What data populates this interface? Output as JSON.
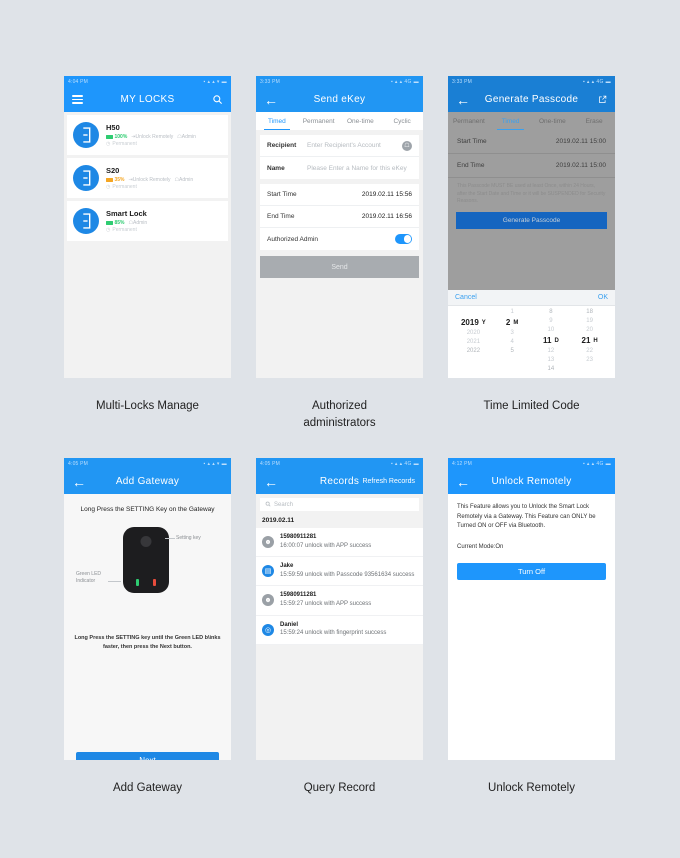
{
  "screens": [
    {
      "caption": "Multi-Locks Manage",
      "statusbar": {
        "time": "4:04 PM",
        "icons": "▪ ▴ ▴ ▾ ▬"
      },
      "nav": {
        "title": "MY LOCKS",
        "menu_icon": "hamburger-icon",
        "search_icon": "search-icon"
      },
      "locks": [
        {
          "name": "H50",
          "battery": "100%",
          "battery_color": "#2ecc71",
          "unlock": "Unlock Remotely",
          "role": "Admin",
          "period": "Permanent"
        },
        {
          "name": "S20",
          "battery": "35%",
          "battery_color": "#f5a623",
          "unlock": "Unlock Remotely",
          "role": "Admin",
          "period": "Permanent"
        },
        {
          "name": "Smart Lock",
          "battery": "85%",
          "battery_color": "#2ecc71",
          "unlock": "",
          "role": "Admin",
          "period": "Permanent"
        }
      ]
    },
    {
      "caption": "Authorized\nadministrators",
      "statusbar": {
        "time": "3:33 PM",
        "icons": "▪ ▴ ▴ 4G ▬"
      },
      "nav": {
        "title": "Send eKey",
        "back_icon": "back-arrow-icon"
      },
      "tabs": [
        {
          "label": "Timed",
          "active": true
        },
        {
          "label": "Permanent",
          "active": false
        },
        {
          "label": "One-time",
          "active": false
        },
        {
          "label": "Cyclic",
          "active": false
        }
      ],
      "fields": {
        "recipient_label": "Recipient",
        "recipient_placeholder": "Enter Recipient's Account",
        "name_label": "Name",
        "name_placeholder": "Please Enter a Name for this eKey",
        "start_label": "Start Time",
        "start_value": "2019.02.11 15:56",
        "end_label": "End Time",
        "end_value": "2019.02.11 16:56",
        "admin_label": "Authorized Admin",
        "admin_on": true
      },
      "send_label": "Send"
    },
    {
      "caption": "Time Limited Code",
      "statusbar": {
        "time": "3:33 PM",
        "icons": "▪ ▴ ▴ 4G ▬"
      },
      "nav": {
        "title": "Generate Passcode",
        "back_icon": "back-arrow-icon",
        "share_icon": "share-icon"
      },
      "tabs": [
        {
          "label": "Permanent",
          "active": false
        },
        {
          "label": "Timed",
          "active": true
        },
        {
          "label": "One-time",
          "active": false
        },
        {
          "label": "Erase",
          "active": false
        }
      ],
      "fields": {
        "start_label": "Start Time",
        "start_value": "2019.02.11 15:00",
        "end_label": "End Time",
        "end_value": "2019.02.11 15:00"
      },
      "warning": "This Passcode MUST BE used at least Once, within 24 Hours, after the Start Date and Time or it will be SUSPENDED for Security Reasons.",
      "generate_label": "Generate Passcode",
      "picker": {
        "cancel": "Cancel",
        "ok": "OK",
        "columns": [
          {
            "unit": "Y",
            "above2": "",
            "above1": "",
            "selected": "2019",
            "below1": "2020",
            "below2": "2021",
            "below3": "2022"
          },
          {
            "unit": "M",
            "above2": "",
            "above1": "",
            "above0": "1",
            "selected": "2",
            "below1": "3",
            "below2": "4",
            "below3": "5"
          },
          {
            "unit": "D",
            "above2": "8",
            "above1": "9",
            "above0": "10",
            "selected": "11",
            "below1": "12",
            "below2": "13",
            "below3": "14"
          },
          {
            "unit": "H",
            "above2": "18",
            "above1": "19",
            "above0": "20",
            "selected": "21",
            "below1": "22",
            "below2": "23",
            "below3": ""
          }
        ]
      }
    },
    {
      "caption": "Add Gateway",
      "statusbar": {
        "time": "4:05 PM",
        "icons": "▪ ▴ ▴ ▾ ▬"
      },
      "nav": {
        "title": "Add Gateway",
        "back_icon": "back-arrow-icon"
      },
      "title": "Long Press the SETTING Key on the Gateway",
      "label_setting": "Setting key",
      "label_led": "Green LED\nIndicator",
      "footer": "Long Press the SETTING key until the Green LED b\\inks faster, then press the Next button.",
      "next_label": "Next"
    },
    {
      "caption": "Query Record",
      "statusbar": {
        "time": "4:05 PM",
        "icons": "▪ ▴ ▴ 4G ▬"
      },
      "nav": {
        "title": "Records",
        "back_icon": "back-arrow-icon",
        "action": "Refresh Records"
      },
      "search_placeholder": "Search",
      "date": "2019.02.11",
      "records": [
        {
          "name": "15980911281",
          "desc": "16:00:07 unlock with APP success",
          "avatar": "user-icon",
          "avatar_color": "#9aa0a6"
        },
        {
          "name": "Jake",
          "desc": "15:59:59 unlock with Passcode 93561634 success",
          "avatar": "keypad-icon",
          "avatar_color": "#1e88e5"
        },
        {
          "name": "15980911281",
          "desc": "15:59:27 unlock with APP success",
          "avatar": "user-icon",
          "avatar_color": "#9aa0a6"
        },
        {
          "name": "Daniel",
          "desc": "15:59:24 unlock with fingerprint success",
          "avatar": "fingerprint-icon",
          "avatar_color": "#1e88e5"
        }
      ]
    },
    {
      "caption": "Unlock Remotely",
      "statusbar": {
        "time": "4:12 PM",
        "icons": "▪ ▴ ▴ 4G ▬"
      },
      "nav": {
        "title": "Unlock Remotely",
        "back_icon": "back-arrow-icon"
      },
      "desc": "This Feature allows you to Unlock the Smart Lock Remotely via a Gateway.  This Feature can ONLY be Turned ON or OFF via Bluetooth.",
      "mode": "Current Mode:On",
      "button_label": "Turn Off"
    }
  ],
  "colors": {
    "background": "#dfe3e8",
    "primary": "#1e96fc",
    "primary_dark": "#1e88e5",
    "battery_good": "#2ecc71",
    "battery_low": "#f5a623"
  }
}
